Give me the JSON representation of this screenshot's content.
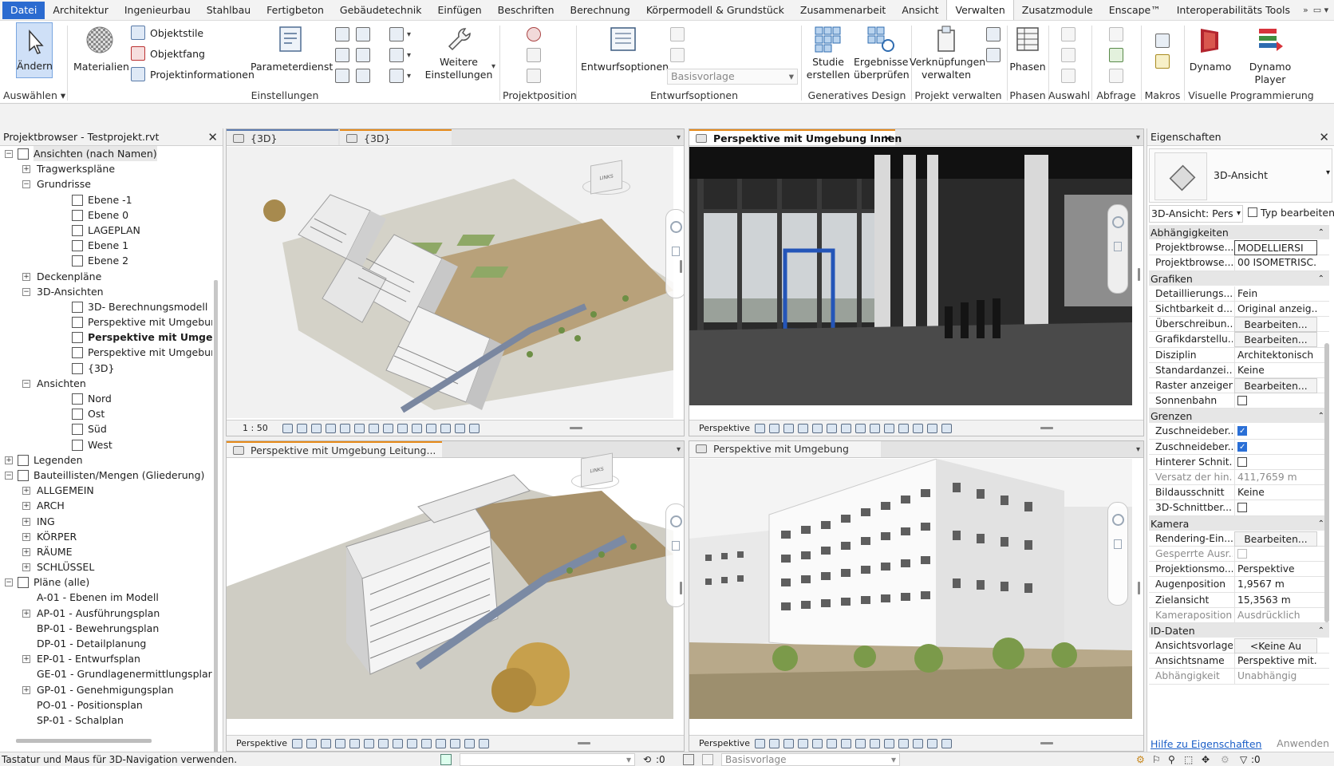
{
  "menu": {
    "tabs": [
      "Datei",
      "Architektur",
      "Ingenieurbau",
      "Stahlbau",
      "Fertigbeton",
      "Gebäudetechnik",
      "Einfügen",
      "Beschriften",
      "Berechnung",
      "Körpermodell & Grundstück",
      "Zusammenarbeit",
      "Ansicht",
      "Verwalten",
      "Zusatzmodule",
      "Enscape™",
      "Interoperabilitäts Tools"
    ],
    "active": "Verwalten"
  },
  "ribbon": {
    "aendern": "Ändern",
    "auswaehlen": "Auswählen",
    "materialien": "Materialien",
    "objektstile": "Objektstile",
    "objektfang": "Objektfang",
    "projektinformationen": "Projektinformationen",
    "parameterdienst": "Parameterdienst",
    "einstellungen_group": "Einstellungen",
    "weitere": "Weitere",
    "einstellungen": "Einstellungen",
    "projektposition": "Projektposition",
    "entwurfsoptionen_btn": "Entwurfsoptionen",
    "basisvorlage": "Basisvorlage",
    "entwurfsoptionen_group": "Entwurfsoptionen",
    "studie": "Studie",
    "erstellen": "erstellen",
    "ergebnisse": "Ergebnisse",
    "ueberpruefen": "überprüfen",
    "generatives_design": "Generatives Design",
    "verknuepfungen": "Verknüpfungen",
    "verwalten": "verwalten",
    "projekt_verwalten": "Projekt verwalten",
    "phasen_btn": "Phasen",
    "phasen_group": "Phasen",
    "auswahl": "Auswahl",
    "abfrage": "Abfrage",
    "makros": "Makros",
    "dynamo": "Dynamo",
    "dynamo_player": "Dynamo Player",
    "visuelle_programmierung": "Visuelle Programmierung"
  },
  "browser": {
    "title": "Projektbrowser - Testprojekt.rvt",
    "tree": [
      {
        "label": "Ansichten (nach Namen)",
        "level": 0,
        "exp": "−",
        "sel": true,
        "icon": true
      },
      {
        "label": "Tragwerkspläne",
        "level": 1,
        "exp": "+"
      },
      {
        "label": "Grundrisse",
        "level": 1,
        "exp": "−"
      },
      {
        "label": "Ebene -1",
        "level": 2,
        "icon": true
      },
      {
        "label": "Ebene 0",
        "level": 2,
        "icon": true
      },
      {
        "label": "LAGEPLAN",
        "level": 2,
        "icon": true
      },
      {
        "label": "Ebene 1",
        "level": 2,
        "icon": true
      },
      {
        "label": "Ebene 2",
        "level": 2,
        "icon": true
      },
      {
        "label": "Deckenpläne",
        "level": 1,
        "exp": "+"
      },
      {
        "label": "3D-Ansichten",
        "level": 1,
        "exp": "−"
      },
      {
        "label": "3D- Berechnungsmodell",
        "level": 2,
        "icon": true
      },
      {
        "label": "Perspektive mit Umgebung",
        "level": 2,
        "icon": true
      },
      {
        "label": "Perspektive mit Umgebung",
        "level": 2,
        "icon": true,
        "bold": true
      },
      {
        "label": "Perspektive mit Umgebung Le",
        "level": 2,
        "icon": true
      },
      {
        "label": "{3D}",
        "level": 2,
        "icon": true
      },
      {
        "label": "Ansichten",
        "level": 1,
        "exp": "−"
      },
      {
        "label": "Nord",
        "level": 2,
        "icon": true
      },
      {
        "label": "Ost",
        "level": 2,
        "icon": true
      },
      {
        "label": "Süd",
        "level": 2,
        "icon": true
      },
      {
        "label": "West",
        "level": 2,
        "icon": true
      },
      {
        "label": "Legenden",
        "level": 0,
        "exp": "+",
        "icon": true
      },
      {
        "label": "Bauteillisten/Mengen (Gliederung)",
        "level": 0,
        "exp": "−",
        "icon": true
      },
      {
        "label": "ALLGEMEIN",
        "level": 1,
        "exp": "+"
      },
      {
        "label": "ARCH",
        "level": 1,
        "exp": "+"
      },
      {
        "label": "ING",
        "level": 1,
        "exp": "+"
      },
      {
        "label": "KÖRPER",
        "level": 1,
        "exp": "+"
      },
      {
        "label": "RÄUME",
        "level": 1,
        "exp": "+"
      },
      {
        "label": "SCHLÜSSEL",
        "level": 1,
        "exp": "+"
      },
      {
        "label": "Pläne (alle)",
        "level": 0,
        "exp": "−",
        "icon": true
      },
      {
        "label": "A-01 - Ebenen im Modell",
        "level": 1
      },
      {
        "label": "AP-01 - Ausführungsplan",
        "level": 1,
        "exp": "+"
      },
      {
        "label": "BP-01 - Bewehrungsplan",
        "level": 1
      },
      {
        "label": "DP-01 - Detailplanung",
        "level": 1
      },
      {
        "label": "EP-01 - Entwurfsplan",
        "level": 1,
        "exp": "+"
      },
      {
        "label": "GE-01 - Grundlagenermittlungsplar",
        "level": 1
      },
      {
        "label": "GP-01 - Genehmigungsplan",
        "level": 1,
        "exp": "+"
      },
      {
        "label": "PO-01 - Positionsplan",
        "level": 1
      },
      {
        "label": "SP-01 - Schalplan",
        "level": 1
      }
    ]
  },
  "views": {
    "tl_tab1": "{3D}",
    "tl_tab2": "{3D}",
    "tl_scale": "1 : 50",
    "tr_tab": "Perspektive mit Umgebung Innen",
    "tr_bar": "Perspektive",
    "bl_tab": "Perspektive mit Umgebung Leitung...",
    "bl_bar": "Perspektive",
    "br_tab": "Perspektive mit Umgebung",
    "br_bar": "Perspektive"
  },
  "props": {
    "title": "Eigenschaften",
    "type_name": "3D-Ansicht",
    "selector": "3D-Ansicht: Pers",
    "typ_bearbeiten": "Typ bearbeiten",
    "rows": [
      {
        "cat": "Abhängigkeiten"
      },
      {
        "name": "Projektbrowse...",
        "value": "MODELLIERSI",
        "kind": "inp"
      },
      {
        "name": "Projektbrowse...",
        "value": "00 ISOMETRISC..."
      },
      {
        "cat": "Grafiken"
      },
      {
        "name": "Detaillierungs...",
        "value": "Fein"
      },
      {
        "name": "Sichtbarkeit d...",
        "value": "Original anzeig..."
      },
      {
        "name": "Überschreibun...",
        "value": "Bearbeiten...",
        "kind": "btn"
      },
      {
        "name": "Grafikdarstellu...",
        "value": "Bearbeiten...",
        "kind": "btn"
      },
      {
        "name": "Disziplin",
        "value": "Architektonisch"
      },
      {
        "name": "Standardanzei...",
        "value": "Keine"
      },
      {
        "name": "Raster anzeigen",
        "value": "Bearbeiten...",
        "kind": "btn"
      },
      {
        "name": "Sonnenbahn",
        "kind": "cb",
        "checked": false
      },
      {
        "cat": "Grenzen"
      },
      {
        "name": "Zuschneideber...",
        "kind": "cb",
        "checked": true
      },
      {
        "name": "Zuschneideber...",
        "kind": "cb",
        "checked": true
      },
      {
        "name": "Hinterer Schnit...",
        "kind": "cb",
        "checked": false
      },
      {
        "name": "Versatz der hin...",
        "value": "411,7659 m",
        "dim": true
      },
      {
        "name": "Bildausschnitt",
        "value": "Keine"
      },
      {
        "name": "3D-Schnittber...",
        "kind": "cb",
        "checked": false
      },
      {
        "cat": "Kamera"
      },
      {
        "name": "Rendering-Ein...",
        "value": "Bearbeiten...",
        "kind": "btn"
      },
      {
        "name": "Gesperrte Ausr...",
        "kind": "cb",
        "checked": false,
        "dim": true
      },
      {
        "name": "Projektionsmo...",
        "value": "Perspektive"
      },
      {
        "name": "Augenposition",
        "value": "1,9567 m"
      },
      {
        "name": "Zielansicht",
        "value": "15,3563 m"
      },
      {
        "name": "Kameraposition",
        "value": "Ausdrücklich",
        "dim": true
      },
      {
        "cat": "ID-Daten"
      },
      {
        "name": "Ansichtsvorlage",
        "value": "<Keine Au",
        "kind": "btn"
      },
      {
        "name": "Ansichtsname",
        "value": "Perspektive mit..."
      },
      {
        "name": "Abhängigkeit",
        "value": "Unabhängig",
        "dim": true
      }
    ],
    "help": "Hilfe zu Eigenschaften",
    "apply": "Anwenden"
  },
  "status": {
    "text": "Tastatur und Maus für 3D-Navigation verwenden.",
    "count": ":0",
    "basisvorlage": "Basisvorlage",
    "filter": ":0"
  }
}
